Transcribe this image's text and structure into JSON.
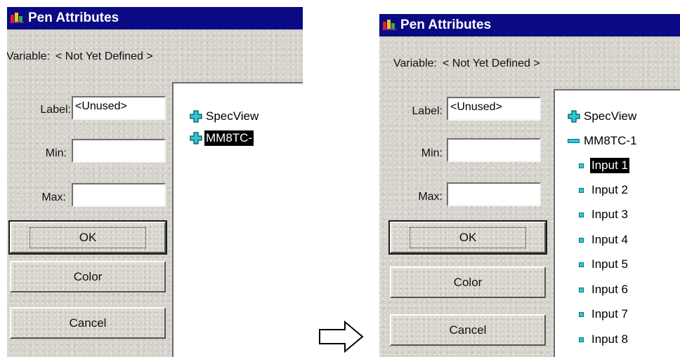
{
  "left_dialog": {
    "title": "Pen Attributes",
    "variable_label": "Variable:",
    "variable_value": "< Not Yet Defined >",
    "label_field_label": "Label:",
    "label_field_value": "<Unused>",
    "min_label": "Min:",
    "min_value": "",
    "max_label": "Max:",
    "max_value": "",
    "ok_label": "OK",
    "color_label": "Color",
    "cancel_label": "Cancel",
    "tree": [
      {
        "label": "SpecView",
        "icon": "plus-icon",
        "selected": false
      },
      {
        "label": "MM8TC-",
        "icon": "plus-icon",
        "selected": true
      }
    ]
  },
  "right_dialog": {
    "title": "Pen Attributes",
    "variable_label": "Variable:",
    "variable_value": "< Not Yet Defined >",
    "label_field_label": "Label:",
    "label_field_value": "<Unused>",
    "min_label": "Min:",
    "min_value": "",
    "max_label": "Max:",
    "max_value": "",
    "ok_label": "OK",
    "color_label": "Color",
    "cancel_label": "Cancel",
    "tree": [
      {
        "label": "SpecView",
        "icon": "plus-icon",
        "selected": false
      },
      {
        "label": "MM8TC-1",
        "icon": "minus-icon",
        "selected": false
      },
      {
        "label": "Input 1",
        "icon": "leaf-icon",
        "selected": true
      },
      {
        "label": "Input 2",
        "icon": "leaf-icon",
        "selected": false
      },
      {
        "label": "Input 3",
        "icon": "leaf-icon",
        "selected": false
      },
      {
        "label": "Input 4",
        "icon": "leaf-icon",
        "selected": false
      },
      {
        "label": "Input 5",
        "icon": "leaf-icon",
        "selected": false
      },
      {
        "label": "Input 6",
        "icon": "leaf-icon",
        "selected": false
      },
      {
        "label": "Input 7",
        "icon": "leaf-icon",
        "selected": false
      },
      {
        "label": "Input 8",
        "icon": "leaf-icon",
        "selected": false
      }
    ]
  },
  "colors": {
    "titlebar": "#0a0a84",
    "dialog_face": "#d6d3cc",
    "tree_icon": "#27c9d8",
    "selection": "#000000"
  },
  "transition_arrow_icon": "right-arrow-icon"
}
